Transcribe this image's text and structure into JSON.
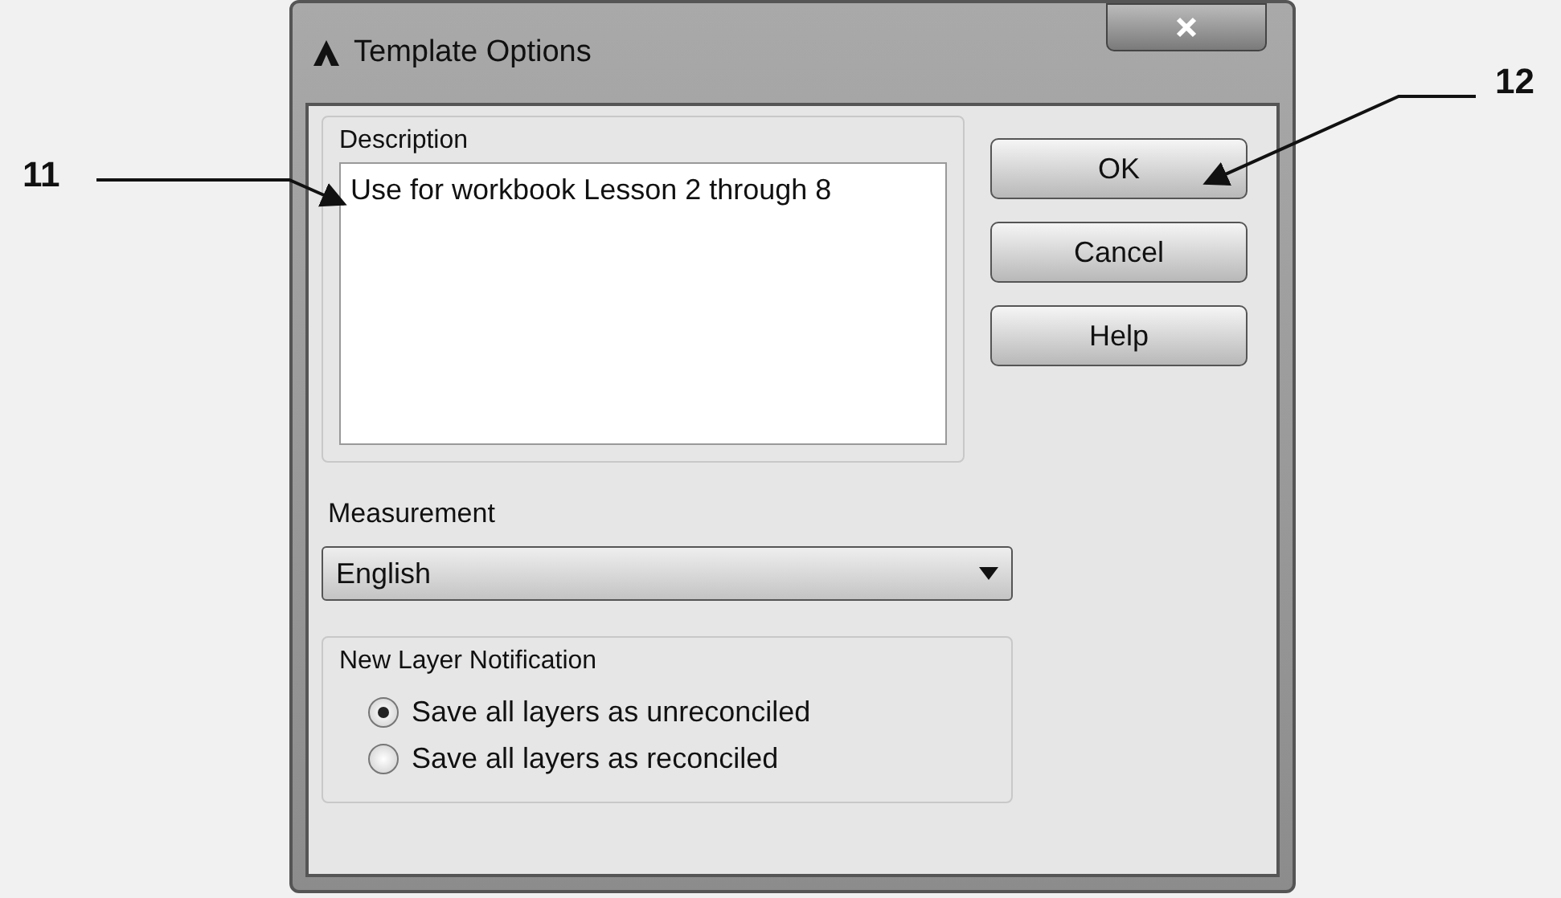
{
  "window": {
    "title": "Template Options"
  },
  "description": {
    "label": "Description",
    "value": "Use for workbook Lesson 2 through 8"
  },
  "buttons": [
    {
      "label": "OK"
    },
    {
      "label": "Cancel"
    },
    {
      "label": "Help"
    }
  ],
  "measurement": {
    "label": "Measurement",
    "value": "English"
  },
  "notification": {
    "label": "New Layer Notification",
    "options": [
      {
        "label": "Save all layers as unreconciled",
        "selected": true
      },
      {
        "label": "Save all layers as reconciled",
        "selected": false
      }
    ]
  },
  "callouts": [
    {
      "label": "11"
    },
    {
      "label": "12"
    }
  ]
}
